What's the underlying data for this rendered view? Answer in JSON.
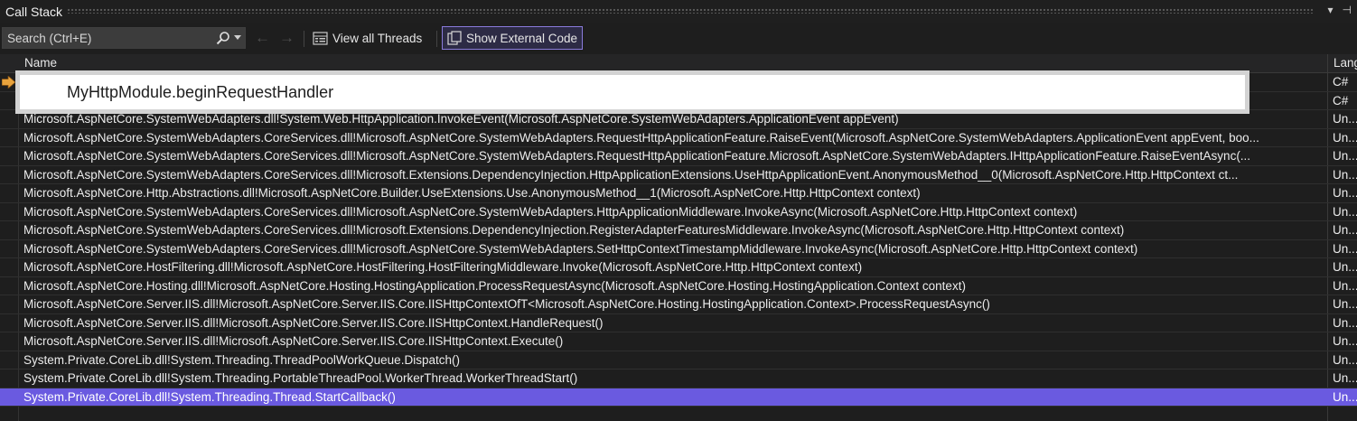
{
  "window": {
    "title": "Call Stack"
  },
  "toolbar": {
    "search_placeholder": "Search (Ctrl+E)",
    "view_all_threads": "View all Threads",
    "show_external_code": "Show External Code"
  },
  "columns": {
    "name": "Name",
    "language": "Lang"
  },
  "highlight": {
    "text": "MyHttpModule.beginRequestHandler"
  },
  "rows": [
    {
      "name": "",
      "lang": "C#"
    },
    {
      "name": "",
      "lang": "C#"
    },
    {
      "name": "Microsoft.AspNetCore.SystemWebAdapters.dll!System.Web.HttpApplication.InvokeEvent(Microsoft.AspNetCore.SystemWebAdapters.ApplicationEvent appEvent)",
      "lang": "Un..."
    },
    {
      "name": "Microsoft.AspNetCore.SystemWebAdapters.CoreServices.dll!Microsoft.AspNetCore.SystemWebAdapters.RequestHttpApplicationFeature.RaiseEvent(Microsoft.AspNetCore.SystemWebAdapters.ApplicationEvent appEvent, boo...",
      "lang": "Un..."
    },
    {
      "name": "Microsoft.AspNetCore.SystemWebAdapters.CoreServices.dll!Microsoft.AspNetCore.SystemWebAdapters.RequestHttpApplicationFeature.Microsoft.AspNetCore.SystemWebAdapters.IHttpApplicationFeature.RaiseEventAsync(...",
      "lang": "Un..."
    },
    {
      "name": "Microsoft.AspNetCore.SystemWebAdapters.CoreServices.dll!Microsoft.Extensions.DependencyInjection.HttpApplicationExtensions.UseHttpApplicationEvent.AnonymousMethod__0(Microsoft.AspNetCore.Http.HttpContext ct...",
      "lang": "Un..."
    },
    {
      "name": "Microsoft.AspNetCore.Http.Abstractions.dll!Microsoft.AspNetCore.Builder.UseExtensions.Use.AnonymousMethod__1(Microsoft.AspNetCore.Http.HttpContext context)",
      "lang": "Un..."
    },
    {
      "name": "Microsoft.AspNetCore.SystemWebAdapters.CoreServices.dll!Microsoft.AspNetCore.SystemWebAdapters.HttpApplicationMiddleware.InvokeAsync(Microsoft.AspNetCore.Http.HttpContext context)",
      "lang": "Un..."
    },
    {
      "name": "Microsoft.AspNetCore.SystemWebAdapters.CoreServices.dll!Microsoft.Extensions.DependencyInjection.RegisterAdapterFeaturesMiddleware.InvokeAsync(Microsoft.AspNetCore.Http.HttpContext context)",
      "lang": "Un..."
    },
    {
      "name": "Microsoft.AspNetCore.SystemWebAdapters.CoreServices.dll!Microsoft.AspNetCore.SystemWebAdapters.SetHttpContextTimestampMiddleware.InvokeAsync(Microsoft.AspNetCore.Http.HttpContext context)",
      "lang": "Un..."
    },
    {
      "name": "Microsoft.AspNetCore.HostFiltering.dll!Microsoft.AspNetCore.HostFiltering.HostFilteringMiddleware.Invoke(Microsoft.AspNetCore.Http.HttpContext context)",
      "lang": "Un..."
    },
    {
      "name": "Microsoft.AspNetCore.Hosting.dll!Microsoft.AspNetCore.Hosting.HostingApplication.ProcessRequestAsync(Microsoft.AspNetCore.Hosting.HostingApplication.Context context)",
      "lang": "Un..."
    },
    {
      "name": "Microsoft.AspNetCore.Server.IIS.dll!Microsoft.AspNetCore.Server.IIS.Core.IISHttpContextOfT<Microsoft.AspNetCore.Hosting.HostingApplication.Context>.ProcessRequestAsync()",
      "lang": "Un..."
    },
    {
      "name": "Microsoft.AspNetCore.Server.IIS.dll!Microsoft.AspNetCore.Server.IIS.Core.IISHttpContext.HandleRequest()",
      "lang": "Un..."
    },
    {
      "name": "Microsoft.AspNetCore.Server.IIS.dll!Microsoft.AspNetCore.Server.IIS.Core.IISHttpContext.Execute()",
      "lang": "Un..."
    },
    {
      "name": "System.Private.CoreLib.dll!System.Threading.ThreadPoolWorkQueue.Dispatch()",
      "lang": "Un..."
    },
    {
      "name": "System.Private.CoreLib.dll!System.Threading.PortableThreadPool.WorkerThread.WorkerThreadStart()",
      "lang": "Un..."
    },
    {
      "name": "System.Private.CoreLib.dll!System.Threading.Thread.StartCallback()",
      "lang": "Un..."
    }
  ],
  "colors": {
    "selection": "#6a5ae0",
    "accent": "#8a7bdc",
    "current_frame_arrow": "#e8a33d"
  },
  "icons": {
    "search": "search-icon",
    "current_frame": "current-frame-arrow-icon",
    "threads": "threads-icon",
    "external_code": "external-code-icon"
  }
}
